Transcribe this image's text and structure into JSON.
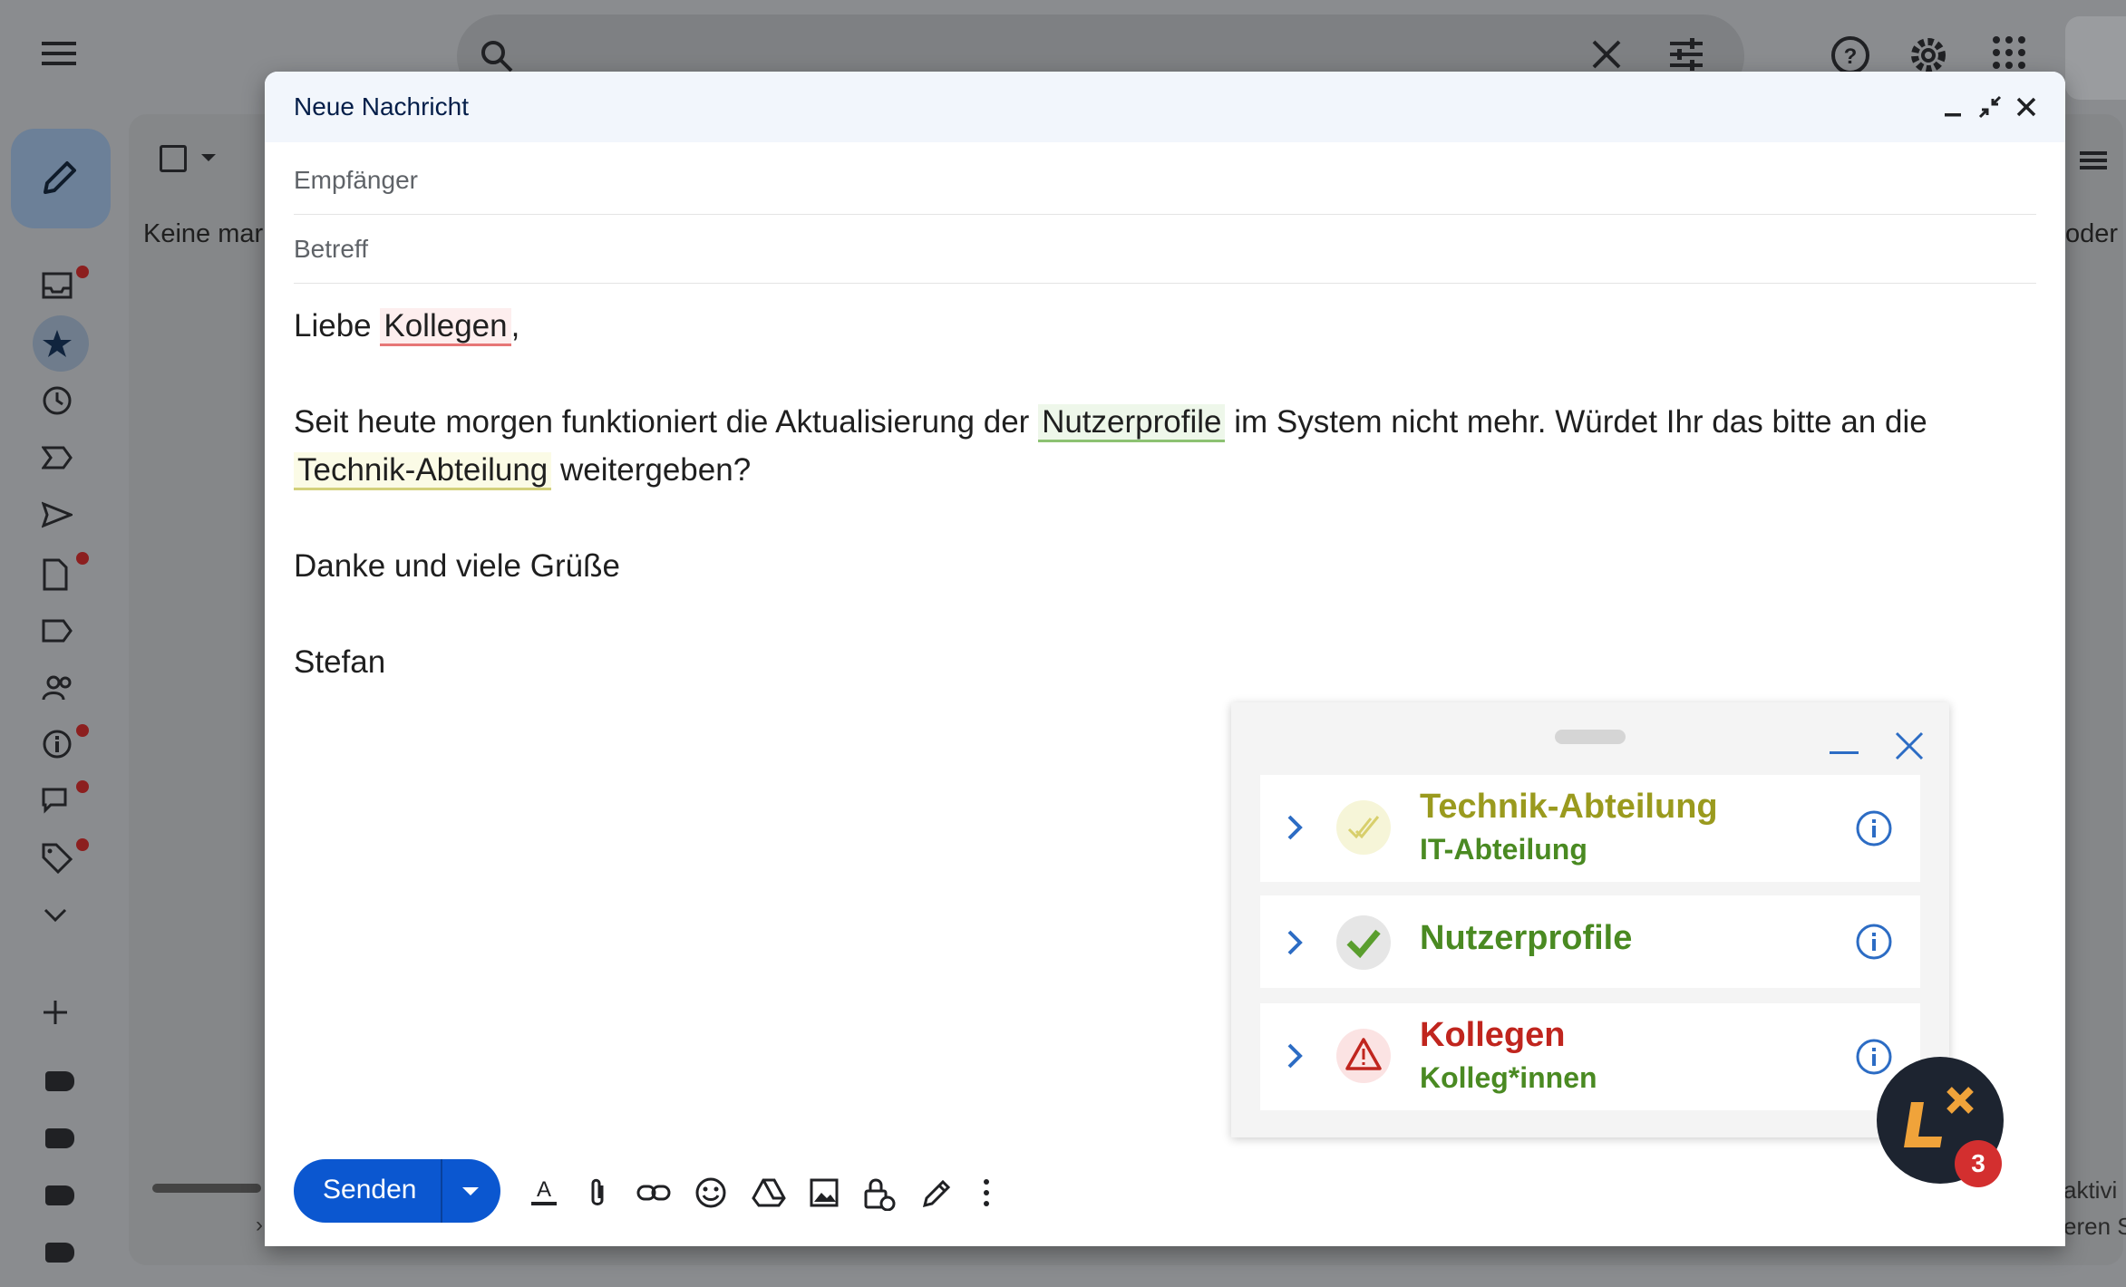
{
  "background": {
    "list_header_text": "Keine mark",
    "list_right_text": "oder",
    "bottom_right_text_1": "aktivi",
    "bottom_right_text_2": "eren St",
    "bottom_left_char": "›",
    "icons": {
      "menu": "hamburger-menu-icon",
      "search": "search-icon",
      "clear": "close-icon",
      "filters": "tune-icon",
      "help": "help-icon",
      "settings": "gear-icon",
      "apps": "apps-grid-icon",
      "compose": "pencil-icon"
    }
  },
  "compose": {
    "title": "Neue Nachricht",
    "to_placeholder": "Empfänger",
    "subject_placeholder": "Betreff",
    "body": {
      "greeting_pre": "Liebe ",
      "greeting_word": "Kollegen",
      "greeting_post": ",",
      "p1_pre": "Seit heute morgen funktioniert die Aktualisierung der ",
      "p1_word1": "Nutzerprofile",
      "p1_mid": " im System nicht mehr. Würdet Ihr das bitte an die ",
      "p1_word2": "Technik-Abteilung",
      "p1_post": " weitergeben?",
      "closing": "Danke und viele Grüße",
      "signature": "Stefan"
    },
    "send_label": "Senden"
  },
  "lt_panel": {
    "items": [
      {
        "title": "Technik-Abteilung",
        "suggestion": "IT-Abteilung",
        "status": "suggestion",
        "title_color": "#9a9a1e"
      },
      {
        "title": "Nutzerprofile",
        "suggestion": "",
        "status": "ok",
        "title_color": "#4a8a22"
      },
      {
        "title": "Kollegen",
        "suggestion": "Kolleg*innen",
        "status": "warning",
        "title_color": "#c0251e"
      }
    ],
    "badge_count": "3",
    "colors": {
      "accent": "#2c6cc4",
      "ok": "#4a8a22",
      "warn": "#c0251e",
      "suggest": "#9a9a1e",
      "brand_orange": "#f0a33a"
    }
  }
}
